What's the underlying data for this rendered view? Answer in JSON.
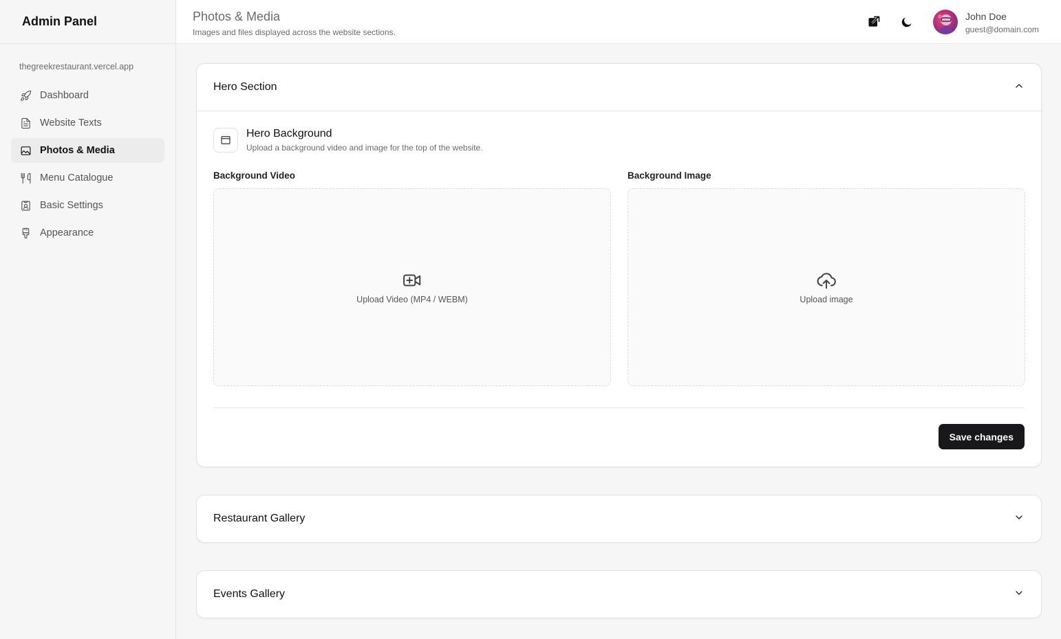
{
  "sidebar": {
    "brand": "Admin Panel",
    "site_url": "thegreekrestaurant.vercel.app",
    "items": [
      {
        "label": "Dashboard",
        "icon": "rocket-icon"
      },
      {
        "label": "Website Texts",
        "icon": "document-icon"
      },
      {
        "label": "Photos & Media",
        "icon": "image-icon",
        "active": true
      },
      {
        "label": "Menu Catalogue",
        "icon": "utensils-icon"
      },
      {
        "label": "Basic Settings",
        "icon": "settings-badge-icon"
      },
      {
        "label": "Appearance",
        "icon": "brush-icon"
      }
    ]
  },
  "header": {
    "title": "Photos & Media",
    "subtitle": "Images and files displayed across the website sections.",
    "external_link_icon": "external-link-icon",
    "theme_toggle_icon": "moon-icon",
    "user": {
      "name": "John Doe",
      "email": "guest@domain.com"
    }
  },
  "hero_section": {
    "title": "Hero Section",
    "expanded": true,
    "sub_title": "Hero Background",
    "sub_desc": "Upload a background video and image for the top of the website.",
    "video_label": "Background Video",
    "video_upload_text": "Upload Video (MP4 / WEBM)",
    "image_label": "Background Image",
    "image_upload_text": "Upload image",
    "save_label": "Save changes"
  },
  "sections": [
    {
      "title": "Restaurant Gallery",
      "expanded": false
    },
    {
      "title": "Events Gallery",
      "expanded": false
    }
  ],
  "colors": {
    "accent": "#18181b",
    "background": "#f6f6f6",
    "surface": "#ffffff",
    "border": "#e2e2e2"
  }
}
